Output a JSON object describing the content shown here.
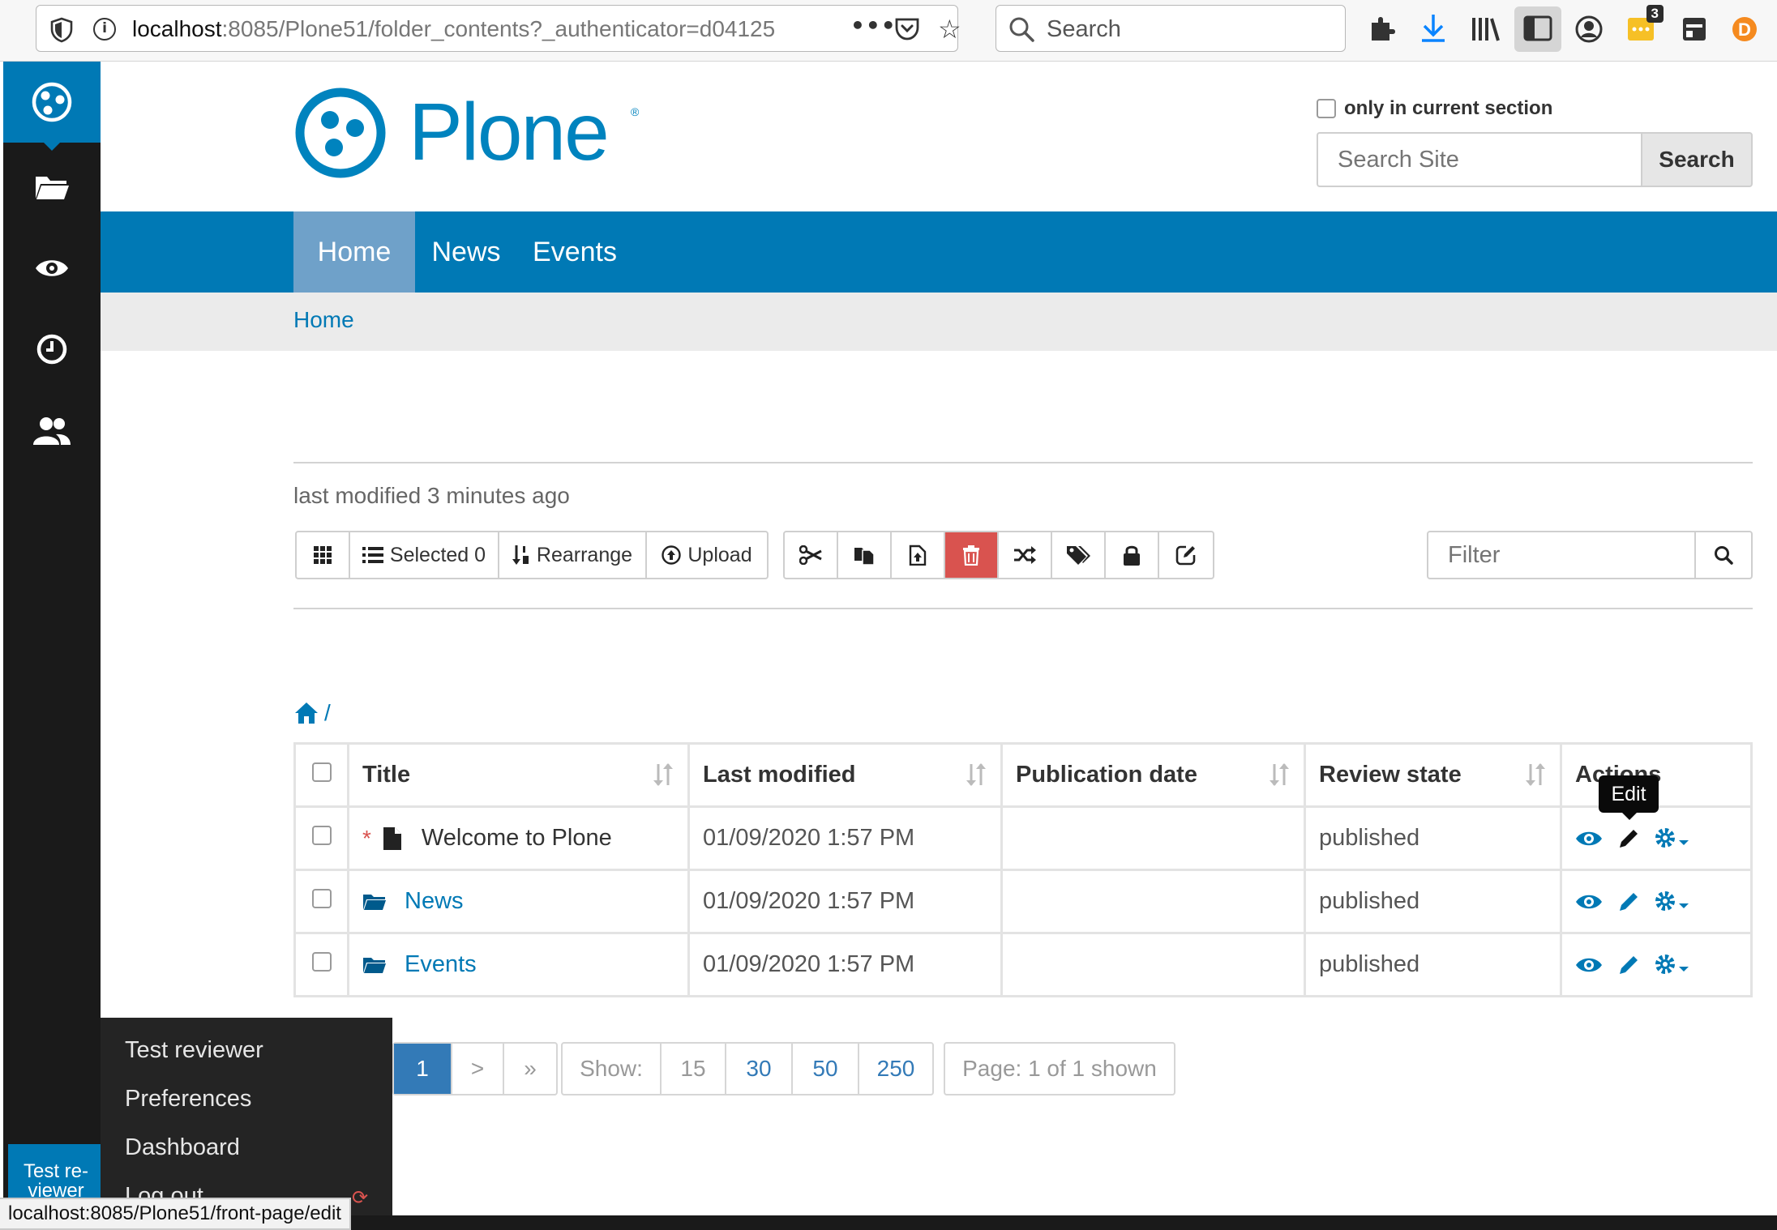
{
  "browser": {
    "url_host": "localhost",
    "url_rest": ":8085/Plone51/folder_contents?_authenticator=d04125",
    "search_placeholder": "Search",
    "badge_count": "3",
    "profile_letter": "D"
  },
  "header": {
    "logo_text": "Plone",
    "logo_reg": "®",
    "only_current_section": "only in current section",
    "search_placeholder": "Search Site",
    "search_button": "Search"
  },
  "nav": {
    "tabs": [
      {
        "label": "Home"
      },
      {
        "label": "News"
      },
      {
        "label": "Events"
      }
    ]
  },
  "breadcrumbs": {
    "home": "Home"
  },
  "content": {
    "last_modified": "last modified 3 minutes ago",
    "toolbar": {
      "selected": "Selected 0",
      "rearrange": "Rearrange",
      "upload": "Upload"
    },
    "filter_placeholder": "Filter",
    "path_sep": "/"
  },
  "table": {
    "columns": [
      "Title",
      "Last modified",
      "Publication date",
      "Review state",
      "Actions"
    ],
    "rows": [
      {
        "title": "Welcome to Plone",
        "modified": "01/09/2020 1:57 PM",
        "pub": "",
        "state": "published"
      },
      {
        "title": "News",
        "modified": "01/09/2020 1:57 PM",
        "pub": "",
        "state": "published"
      },
      {
        "title": "Events",
        "modified": "01/09/2020 1:57 PM",
        "pub": "",
        "state": "published"
      }
    ],
    "tooltip": "Edit"
  },
  "pagination": {
    "current": "1",
    "next": ">",
    "last": "»",
    "show_label": "Show:",
    "sizes": [
      "15",
      "30",
      "50",
      "250"
    ],
    "summary": "Page: 1 of 1 shown"
  },
  "user_menu": {
    "items": [
      "Test reviewer",
      "Preferences",
      "Dashboard",
      "Log out"
    ],
    "user_tab": "Test re-viewer"
  },
  "status_url": "localhost:8085/Plone51/front-page/edit",
  "colors": {
    "plone_blue": "#0079b5",
    "danger": "#d9534f",
    "toolbar_dark": "#1a1a1a"
  }
}
